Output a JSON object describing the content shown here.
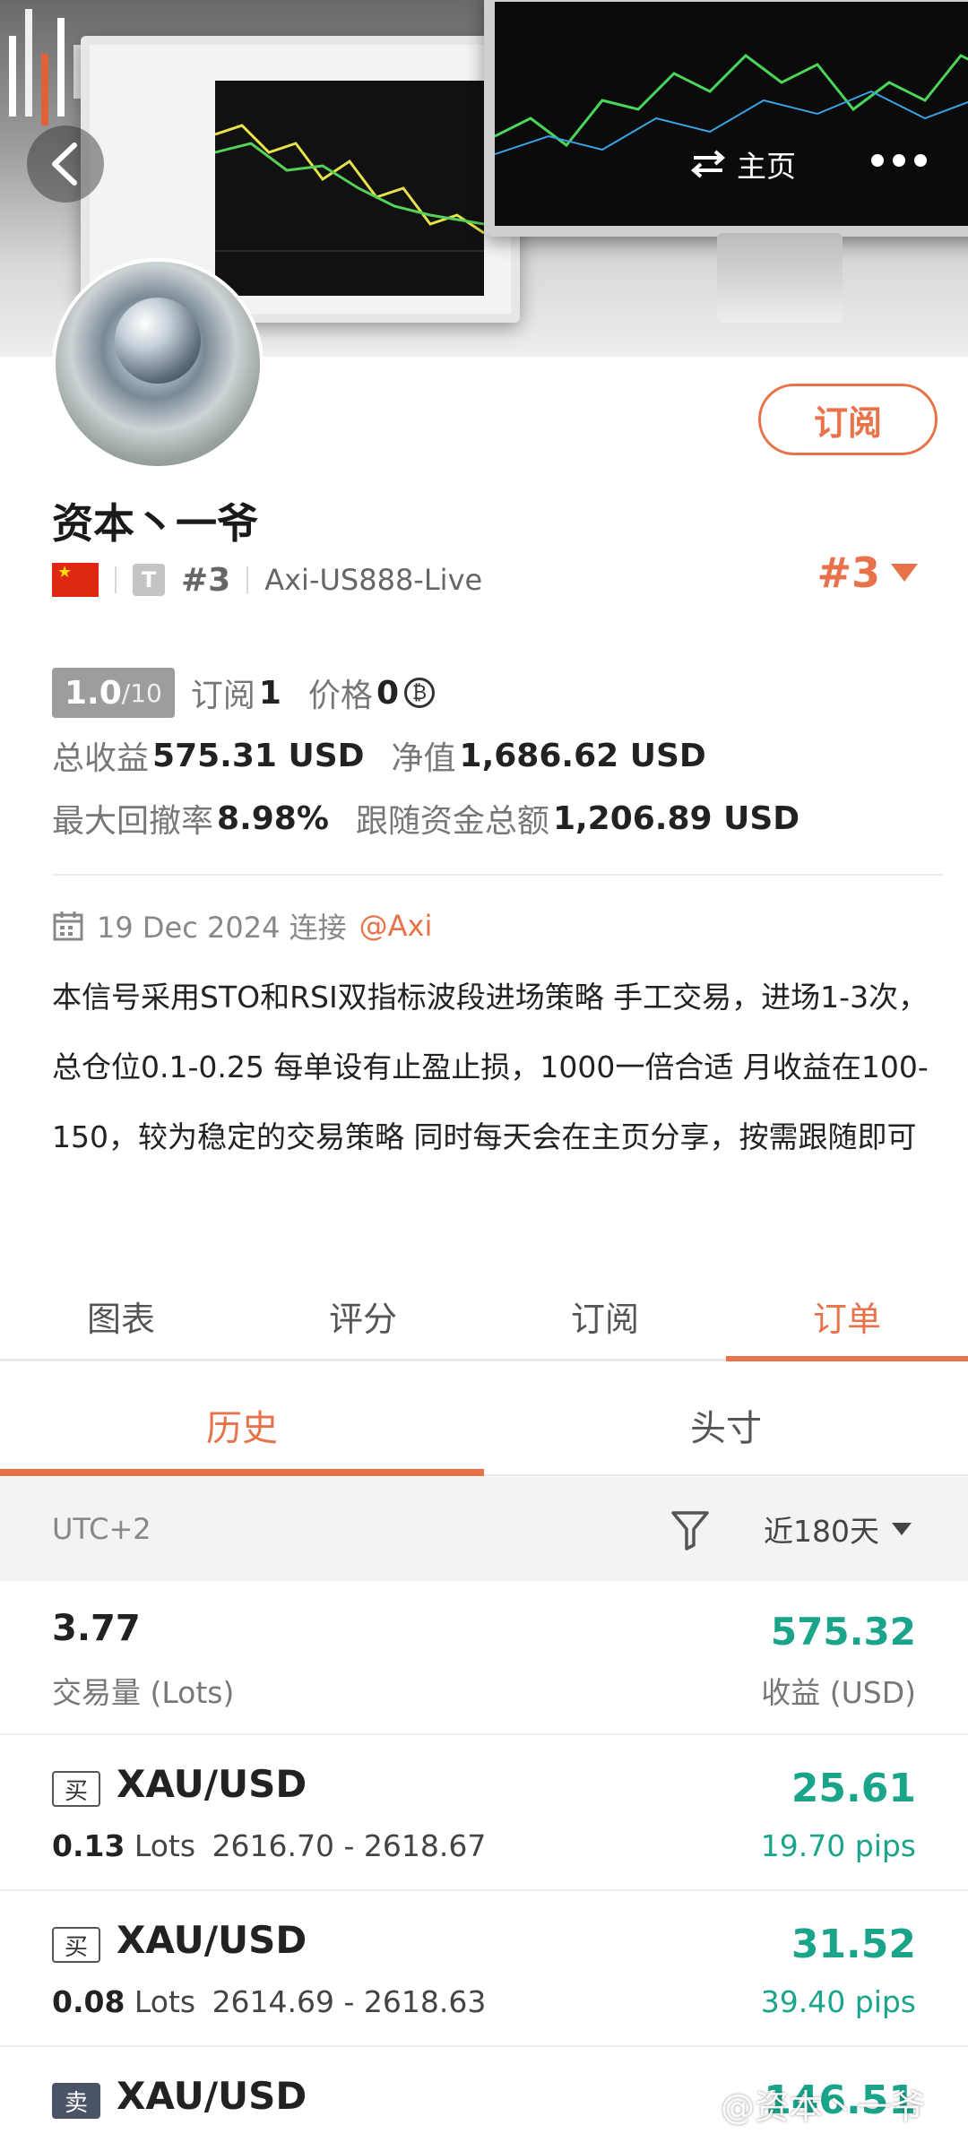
{
  "header": {
    "home_label": "主页",
    "colors": {
      "accent": "#e8734a",
      "profit": "#1aa58b"
    }
  },
  "profile": {
    "name": "资本丶一爷",
    "subscribe_label": "订阅",
    "rank_small": "#3",
    "server": "Axi-US888-Live",
    "rank_big": "#3",
    "t_badge": "T"
  },
  "stats": {
    "rating_value": "1.0",
    "rating_max": "/10",
    "subscribe_label": "订阅",
    "subscribe_count": "1",
    "price_label": "价格",
    "price_value": "0",
    "total_profit_label": "总收益",
    "total_profit_value": "575.31 USD",
    "equity_label": "净值",
    "equity_value": "1,686.62 USD",
    "max_drawdown_label": "最大回撤率",
    "max_drawdown_value": "8.98%",
    "follow_funds_label": "跟随资金总额",
    "follow_funds_value": "1,206.89 USD"
  },
  "connect": {
    "date_text": "19 Dec 2024 连接",
    "broker": "@Axi"
  },
  "description": "本信号采用STO和RSI双指标波段进场策略 手工交易，进场1-3次，总仓位0.1-0.25 每单设有止盈止损，1000一倍合适 月收益在100-150，较为稳定的交易策略 同时每天会在主页分享，按需跟随即可",
  "tabs": [
    {
      "label": "图表"
    },
    {
      "label": "评分"
    },
    {
      "label": "订阅"
    },
    {
      "label": "订单"
    }
  ],
  "subtabs": [
    {
      "label": "历史"
    },
    {
      "label": "头寸"
    }
  ],
  "filter": {
    "timezone": "UTC+2",
    "range": "近180天"
  },
  "summary": {
    "lots": "3.77",
    "lots_label": "交易量 (Lots)",
    "profit": "575.32",
    "profit_label": "收益 (USD)"
  },
  "orders": [
    {
      "side": "买",
      "symbol": "XAU/USD",
      "lots": "0.13",
      "lots_unit": "Lots",
      "prices": "2616.70 - 2618.67",
      "profit": "25.61",
      "pips": "19.70 pips"
    },
    {
      "side": "买",
      "symbol": "XAU/USD",
      "lots": "0.08",
      "lots_unit": "Lots",
      "prices": "2614.69 - 2618.63",
      "profit": "31.52",
      "pips": "39.40 pips"
    },
    {
      "side": "卖",
      "symbol": "XAU/USD",
      "lots": "",
      "lots_unit": "",
      "prices": "",
      "profit": "146.51",
      "pips": ""
    }
  ],
  "watermark": "@资本丶一爷"
}
